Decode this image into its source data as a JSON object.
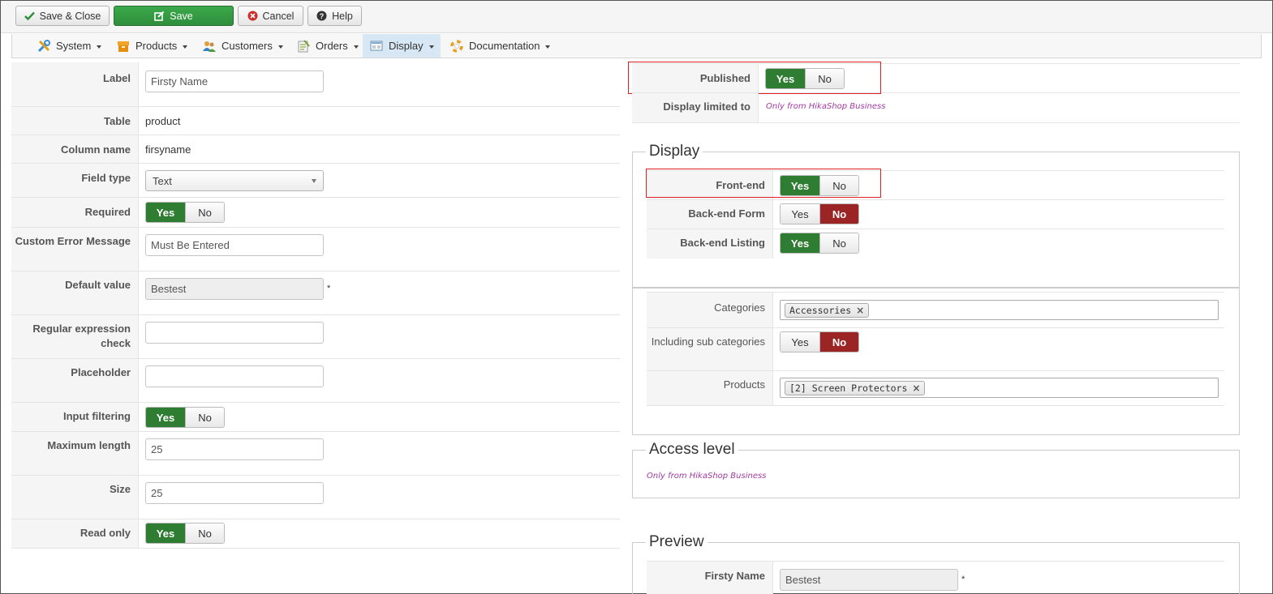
{
  "toolbar": {
    "save_close": "Save & Close",
    "save": "Save",
    "cancel": "Cancel",
    "help": "Help"
  },
  "menu": [
    {
      "label": "System",
      "icon": "tools-icon"
    },
    {
      "label": "Products",
      "icon": "box-icon"
    },
    {
      "label": "Customers",
      "icon": "users-icon"
    },
    {
      "label": "Orders",
      "icon": "orders-icon"
    },
    {
      "label": "Display",
      "icon": "display-icon",
      "active": true
    },
    {
      "label": "Documentation",
      "icon": "help-ring-icon"
    }
  ],
  "form": {
    "label": {
      "label": "Label",
      "value": "Firsty Name"
    },
    "table": {
      "label": "Table",
      "value": "product"
    },
    "column_name": {
      "label": "Column name",
      "value": "firsyname"
    },
    "field_type": {
      "label": "Field type",
      "value": "Text"
    },
    "required": {
      "label": "Required",
      "yes": "Yes",
      "no": "No",
      "selected": "Yes"
    },
    "custom_error": {
      "label": "Custom Error Message",
      "value": "Must Be Entered"
    },
    "default_value": {
      "label": "Default value",
      "value": "Bestest",
      "star": "*"
    },
    "regex": {
      "label": "Regular expression check",
      "value": ""
    },
    "placeholder": {
      "label": "Placeholder",
      "value": ""
    },
    "input_filtering": {
      "label": "Input filtering",
      "yes": "Yes",
      "no": "No",
      "selected": "Yes"
    },
    "max_length": {
      "label": "Maximum length",
      "value": "25"
    },
    "size": {
      "label": "Size",
      "value": "25"
    },
    "read_only": {
      "label": "Read only",
      "yes": "Yes",
      "no": "No",
      "selected": "Yes"
    }
  },
  "right": {
    "published": {
      "label": "Published",
      "yes": "Yes",
      "no": "No",
      "selected": "Yes"
    },
    "display_limited": {
      "label": "Display limited to",
      "note": "Only from HikaShop Business"
    },
    "display": {
      "legend": "Display",
      "front_end": {
        "label": "Front-end",
        "yes": "Yes",
        "no": "No",
        "selected": "Yes"
      },
      "backend_form": {
        "label": "Back-end Form",
        "yes": "Yes",
        "no": "No",
        "selected": "No"
      },
      "backend_listing": {
        "label": "Back-end Listing",
        "yes": "Yes",
        "no": "No",
        "selected": "Yes"
      }
    },
    "categories": {
      "label": "Categories",
      "tag": "Accessories",
      "remove": "×"
    },
    "including_sub": {
      "label": "Including sub categories",
      "yes": "Yes",
      "no": "No",
      "selected": "No"
    },
    "products": {
      "label": "Products",
      "tag": "[2] Screen Protectors",
      "remove": "×"
    },
    "access": {
      "legend": "Access level",
      "note": "Only from HikaShop Business"
    },
    "preview": {
      "legend": "Preview",
      "label": "Firsty Name",
      "value": "Bestest",
      "star": "*"
    }
  },
  "colors": {
    "yes_on": "#2f7d32",
    "no_on": "#9b2424",
    "highlight": "#e02020",
    "business": "#a23aa3"
  }
}
